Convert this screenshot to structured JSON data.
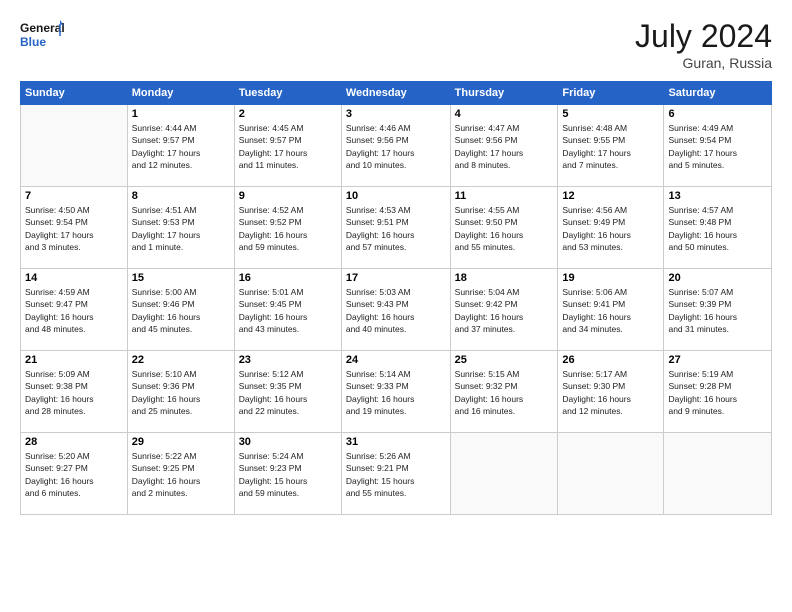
{
  "header": {
    "logo_general": "General",
    "logo_blue": "Blue",
    "month_year": "July 2024",
    "location": "Guran, Russia"
  },
  "days_of_week": [
    "Sunday",
    "Monday",
    "Tuesday",
    "Wednesday",
    "Thursday",
    "Friday",
    "Saturday"
  ],
  "weeks": [
    [
      {
        "day": "",
        "info": ""
      },
      {
        "day": "1",
        "info": "Sunrise: 4:44 AM\nSunset: 9:57 PM\nDaylight: 17 hours\nand 12 minutes."
      },
      {
        "day": "2",
        "info": "Sunrise: 4:45 AM\nSunset: 9:57 PM\nDaylight: 17 hours\nand 11 minutes."
      },
      {
        "day": "3",
        "info": "Sunrise: 4:46 AM\nSunset: 9:56 PM\nDaylight: 17 hours\nand 10 minutes."
      },
      {
        "day": "4",
        "info": "Sunrise: 4:47 AM\nSunset: 9:56 PM\nDaylight: 17 hours\nand 8 minutes."
      },
      {
        "day": "5",
        "info": "Sunrise: 4:48 AM\nSunset: 9:55 PM\nDaylight: 17 hours\nand 7 minutes."
      },
      {
        "day": "6",
        "info": "Sunrise: 4:49 AM\nSunset: 9:54 PM\nDaylight: 17 hours\nand 5 minutes."
      }
    ],
    [
      {
        "day": "7",
        "info": "Sunrise: 4:50 AM\nSunset: 9:54 PM\nDaylight: 17 hours\nand 3 minutes."
      },
      {
        "day": "8",
        "info": "Sunrise: 4:51 AM\nSunset: 9:53 PM\nDaylight: 17 hours\nand 1 minute."
      },
      {
        "day": "9",
        "info": "Sunrise: 4:52 AM\nSunset: 9:52 PM\nDaylight: 16 hours\nand 59 minutes."
      },
      {
        "day": "10",
        "info": "Sunrise: 4:53 AM\nSunset: 9:51 PM\nDaylight: 16 hours\nand 57 minutes."
      },
      {
        "day": "11",
        "info": "Sunrise: 4:55 AM\nSunset: 9:50 PM\nDaylight: 16 hours\nand 55 minutes."
      },
      {
        "day": "12",
        "info": "Sunrise: 4:56 AM\nSunset: 9:49 PM\nDaylight: 16 hours\nand 53 minutes."
      },
      {
        "day": "13",
        "info": "Sunrise: 4:57 AM\nSunset: 9:48 PM\nDaylight: 16 hours\nand 50 minutes."
      }
    ],
    [
      {
        "day": "14",
        "info": "Sunrise: 4:59 AM\nSunset: 9:47 PM\nDaylight: 16 hours\nand 48 minutes."
      },
      {
        "day": "15",
        "info": "Sunrise: 5:00 AM\nSunset: 9:46 PM\nDaylight: 16 hours\nand 45 minutes."
      },
      {
        "day": "16",
        "info": "Sunrise: 5:01 AM\nSunset: 9:45 PM\nDaylight: 16 hours\nand 43 minutes."
      },
      {
        "day": "17",
        "info": "Sunrise: 5:03 AM\nSunset: 9:43 PM\nDaylight: 16 hours\nand 40 minutes."
      },
      {
        "day": "18",
        "info": "Sunrise: 5:04 AM\nSunset: 9:42 PM\nDaylight: 16 hours\nand 37 minutes."
      },
      {
        "day": "19",
        "info": "Sunrise: 5:06 AM\nSunset: 9:41 PM\nDaylight: 16 hours\nand 34 minutes."
      },
      {
        "day": "20",
        "info": "Sunrise: 5:07 AM\nSunset: 9:39 PM\nDaylight: 16 hours\nand 31 minutes."
      }
    ],
    [
      {
        "day": "21",
        "info": "Sunrise: 5:09 AM\nSunset: 9:38 PM\nDaylight: 16 hours\nand 28 minutes."
      },
      {
        "day": "22",
        "info": "Sunrise: 5:10 AM\nSunset: 9:36 PM\nDaylight: 16 hours\nand 25 minutes."
      },
      {
        "day": "23",
        "info": "Sunrise: 5:12 AM\nSunset: 9:35 PM\nDaylight: 16 hours\nand 22 minutes."
      },
      {
        "day": "24",
        "info": "Sunrise: 5:14 AM\nSunset: 9:33 PM\nDaylight: 16 hours\nand 19 minutes."
      },
      {
        "day": "25",
        "info": "Sunrise: 5:15 AM\nSunset: 9:32 PM\nDaylight: 16 hours\nand 16 minutes."
      },
      {
        "day": "26",
        "info": "Sunrise: 5:17 AM\nSunset: 9:30 PM\nDaylight: 16 hours\nand 12 minutes."
      },
      {
        "day": "27",
        "info": "Sunrise: 5:19 AM\nSunset: 9:28 PM\nDaylight: 16 hours\nand 9 minutes."
      }
    ],
    [
      {
        "day": "28",
        "info": "Sunrise: 5:20 AM\nSunset: 9:27 PM\nDaylight: 16 hours\nand 6 minutes."
      },
      {
        "day": "29",
        "info": "Sunrise: 5:22 AM\nSunset: 9:25 PM\nDaylight: 16 hours\nand 2 minutes."
      },
      {
        "day": "30",
        "info": "Sunrise: 5:24 AM\nSunset: 9:23 PM\nDaylight: 15 hours\nand 59 minutes."
      },
      {
        "day": "31",
        "info": "Sunrise: 5:26 AM\nSunset: 9:21 PM\nDaylight: 15 hours\nand 55 minutes."
      },
      {
        "day": "",
        "info": ""
      },
      {
        "day": "",
        "info": ""
      },
      {
        "day": "",
        "info": ""
      }
    ]
  ]
}
